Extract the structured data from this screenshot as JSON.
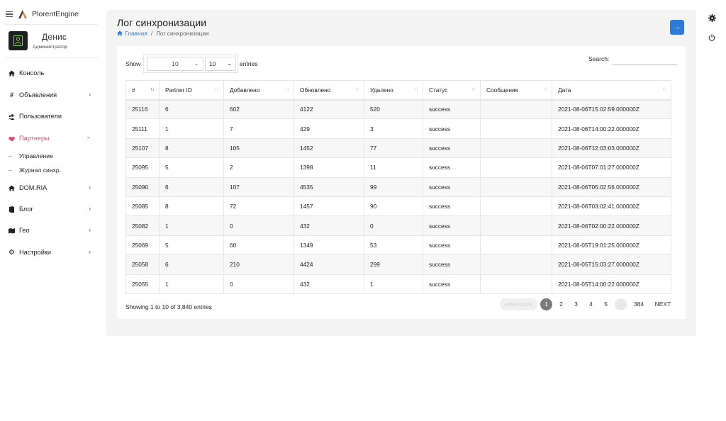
{
  "app": {
    "name": "PlorentEngine"
  },
  "user": {
    "name": "Денис",
    "role": "Администратор"
  },
  "sidebar": {
    "items": [
      {
        "label": "Консоль",
        "icon": "home-icon",
        "chevron": ""
      },
      {
        "label": "Объявления",
        "icon": "hashtag-icon",
        "chevron": "›"
      },
      {
        "label": "Пользователи",
        "icon": "users-icon",
        "chevron": ""
      },
      {
        "label": "Партнеры",
        "icon": "handshake-icon",
        "chevron": "⌄"
      },
      {
        "label": "DOM.RIA",
        "icon": "home-icon",
        "chevron": "›"
      },
      {
        "label": "Блог",
        "icon": "book-icon",
        "chevron": "›"
      },
      {
        "label": "Гео",
        "icon": "map-icon",
        "chevron": "›"
      },
      {
        "label": "Настройки",
        "icon": "gear-icon",
        "chevron": "›"
      }
    ],
    "subitems": [
      {
        "label": "Управление"
      },
      {
        "label": "Журнал синхр."
      }
    ],
    "active_color": "#d94f6d"
  },
  "page": {
    "title": "Лог синхронизации",
    "breadcrumb_home": "Главная",
    "breadcrumb_current": "Лог синхронизации",
    "top_button_icon": "arrow-right-icon",
    "accent_color": "#2f79d8"
  },
  "table_controls": {
    "show_label": "Show",
    "length_value_a": "10",
    "length_value_b": "10",
    "entries_label": "entries",
    "search_label": "Search:",
    "search_value": ""
  },
  "table": {
    "columns": [
      "#",
      "Partner ID",
      "Добавлено",
      "Обновлено",
      "Удалено",
      "Статус",
      "Сообщение",
      "Дата"
    ],
    "rows": [
      [
        "25116",
        "6",
        "602",
        "4122",
        "520",
        "success",
        "",
        "2021-08-06T15:02:59.000000Z"
      ],
      [
        "25111",
        "1",
        "7",
        "429",
        "3",
        "success",
        "",
        "2021-08-06T14:00:22.000000Z"
      ],
      [
        "25107",
        "8",
        "105",
        "1452",
        "77",
        "success",
        "",
        "2021-08-06T12:03:03.000000Z"
      ],
      [
        "25095",
        "5",
        "2",
        "1398",
        "11",
        "success",
        "",
        "2021-08-06T07:01:27.000000Z"
      ],
      [
        "25090",
        "6",
        "107",
        "4535",
        "99",
        "success",
        "",
        "2021-08-06T05:02:56.000000Z"
      ],
      [
        "25085",
        "8",
        "72",
        "1457",
        "90",
        "success",
        "",
        "2021-08-06T03:02:41.000000Z"
      ],
      [
        "25082",
        "1",
        "0",
        "432",
        "0",
        "success",
        "",
        "2021-08-06T02:00:22.000000Z"
      ],
      [
        "25069",
        "5",
        "60",
        "1349",
        "53",
        "success",
        "",
        "2021-08-05T19:01:25.000000Z"
      ],
      [
        "25058",
        "6",
        "210",
        "4424",
        "299",
        "success",
        "",
        "2021-08-05T15:03:27.000000Z"
      ],
      [
        "25055",
        "1",
        "0",
        "432",
        "1",
        "success",
        "",
        "2021-08-05T14:00:22.000000Z"
      ]
    ]
  },
  "footer": {
    "info": "Showing 1 to 10 of 3,840 entries",
    "pagination": {
      "prev": "PREVIOUS",
      "pages": [
        "1",
        "2",
        "3",
        "4",
        "5",
        "…",
        "384"
      ],
      "current": "1",
      "next": "NEXT"
    }
  },
  "right_icons": [
    "gear-icon",
    "power-icon"
  ]
}
